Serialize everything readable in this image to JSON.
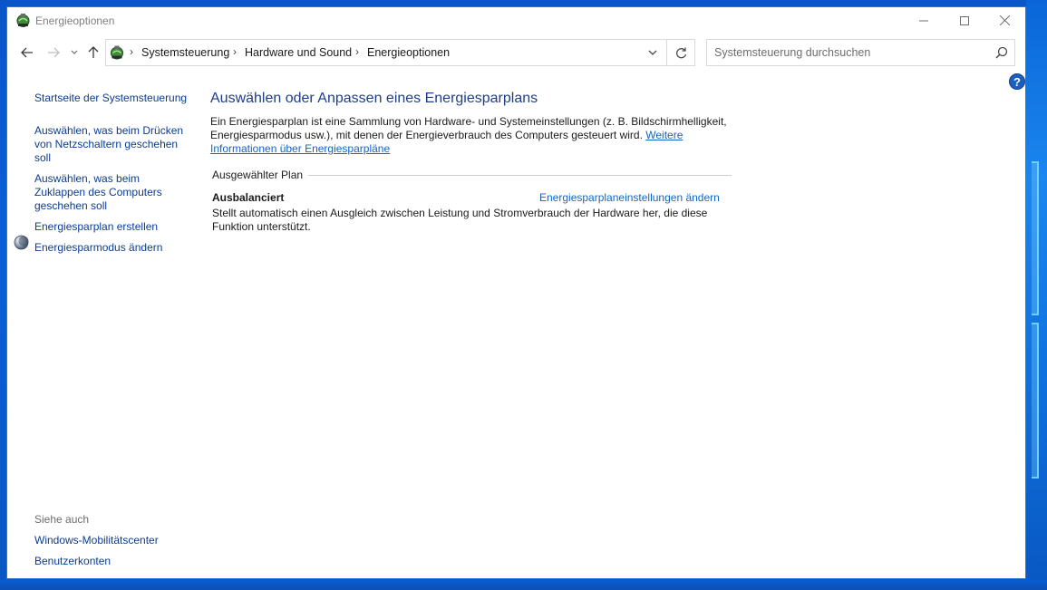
{
  "window": {
    "title": "Energieoptionen"
  },
  "navigation": {
    "breadcrumbs": [
      "Systemsteuerung",
      "Hardware und Sound",
      "Energieoptionen"
    ],
    "search_placeholder": "Systemsteuerung durchsuchen"
  },
  "sidebar": {
    "items": [
      {
        "label": "Startseite der Systemsteuerung"
      },
      {
        "label": "Auswählen, was beim Drücken von Netzschaltern geschehen soll"
      },
      {
        "label": "Auswählen, was beim Zuklappen des Computers geschehen soll"
      },
      {
        "label": "Energiesparplan erstellen"
      },
      {
        "label": "Energiesparmodus ändern"
      }
    ],
    "see_also_heading": "Siehe auch",
    "see_also": [
      {
        "label": "Windows-Mobilitätscenter"
      },
      {
        "label": "Benutzerkonten"
      }
    ]
  },
  "main": {
    "title": "Auswählen oder Anpassen eines Energiesparplans",
    "description": "Ein Energiesparplan ist eine Sammlung von Hardware- und Systemeinstellungen (z. B. Bildschirmhelligkeit, Energiesparmodus usw.), mit denen der Energieverbrauch des Computers gesteuert wird.",
    "more_info_link": "Weitere Informationen über Energiesparpläne",
    "selected_plan_heading": "Ausgewählter Plan",
    "plan": {
      "name": "Ausbalanciert",
      "settings_link": "Energiesparplaneinstellungen ändern",
      "description": "Stellt automatisch einen Ausgleich zwischen Leistung und Stromverbrauch der Hardware her, die diese Funktion unterstützt."
    }
  },
  "help": {
    "symbol": "?"
  },
  "colors": {
    "link": "#0b3d91",
    "title_blue": "#1e3e8a",
    "hyperlink": "#1565c0",
    "desktop": "#0a55c8"
  }
}
